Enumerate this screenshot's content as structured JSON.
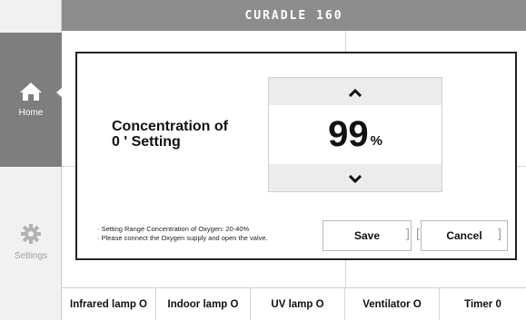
{
  "header": {
    "title": "CURADLE 160"
  },
  "sidebar": {
    "home_label": "Home",
    "settings_label": "Settings"
  },
  "dialog": {
    "title": "Concentration of\n0 ' Setting",
    "value": "99",
    "unit": "%",
    "notes": [
      "· Setting Range Concentration of Oxygen: 20-40%",
      "· Please connect the Oxygen supply and open the valve."
    ],
    "save_label": "Save",
    "cancel_label": "Cancel",
    "bracket_left": "]",
    "bracket_mid": "[",
    "bracket_right": "]"
  },
  "devices": [
    {
      "label": "Infrared lamp O"
    },
    {
      "label": "Indoor lamp O"
    },
    {
      "label": "UV lamp O"
    },
    {
      "label": "Ventilator O"
    },
    {
      "label": "Timer 0"
    }
  ],
  "colors": {
    "header_bg": "#8c8c8c",
    "nav_active_bg": "#7e7e7e",
    "dialog_border": "#222222",
    "stepper_arrow_bg": "#ececec"
  }
}
